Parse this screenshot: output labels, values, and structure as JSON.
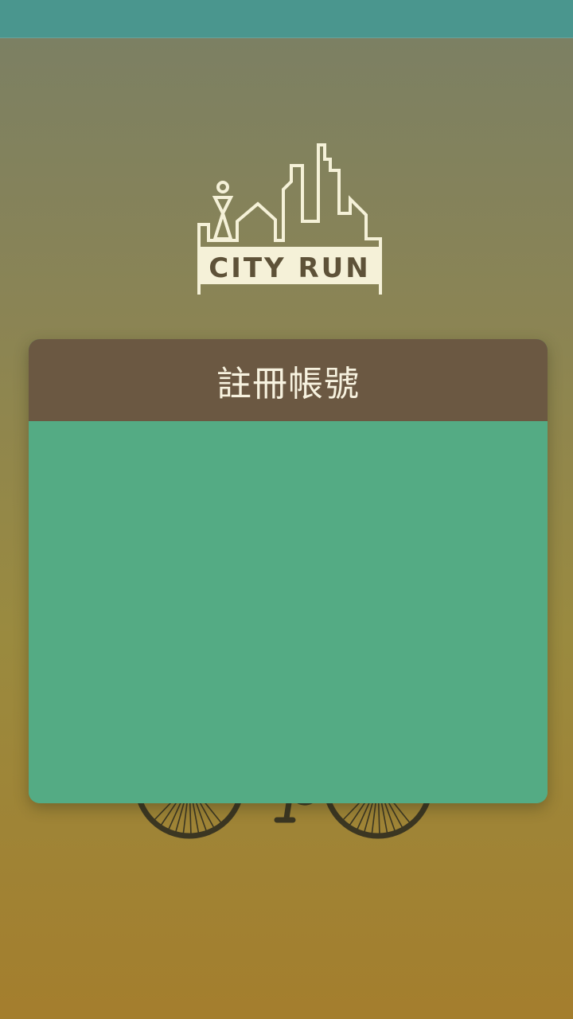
{
  "app": {
    "logo_text": "CITY RUN",
    "logo_icon": "city-skyline-runner-icon",
    "background_icon": "bicycle-icon"
  },
  "register_card": {
    "title": "註冊帳號"
  },
  "colors": {
    "status_bar": "#4a968e",
    "card_header": "#6b5842",
    "card_body": "#54ab84",
    "logo_stroke": "#f5f1d8",
    "title_text": "#f7f2df"
  }
}
